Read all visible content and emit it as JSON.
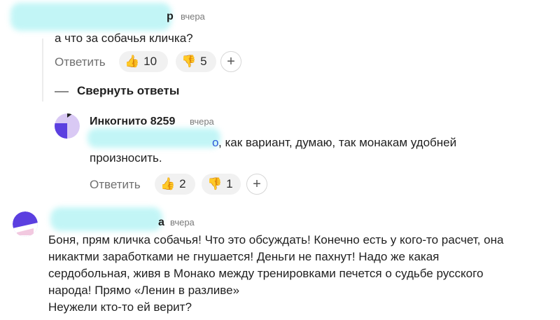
{
  "comments": [
    {
      "time": "вчера",
      "name_tail": "р",
      "text": "а что за собачья кличка?",
      "reply_label": "Ответить",
      "likes": "10",
      "dislikes": "5"
    },
    {
      "collapse_label": "Свернуть ответы"
    },
    {
      "name": "Инкогнито 8259",
      "time": "вчера",
      "mention_tail": "о",
      "text_line1": ", как вариант, думаю, так монакам удобней",
      "text_line2": "произносить.",
      "reply_label": "Ответить",
      "likes": "2",
      "dislikes": "1"
    },
    {
      "time": "вчера",
      "name_tail": "а",
      "lines": [
        "Боня, прям кличка собачья! Что это обсуждать! Конечно есть у кого-то расчет, она",
        "никактми заработками не гнушается! Деньги не пахнут! Надо же какая",
        "сердобольная, живя в Монако между тренировками печется о судьбе русского",
        "народа! Прямо «Ленин в разливе»",
        "Неужели кто-то ей верит?"
      ]
    }
  ],
  "icons": {
    "like": "thumbs-up-icon",
    "dislike": "thumbs-down-icon",
    "add": "plus-icon"
  },
  "colors": {
    "blur": "#bff5f6",
    "mention": "#2f5bd8",
    "avatar_purple": "#5b3fe0"
  }
}
